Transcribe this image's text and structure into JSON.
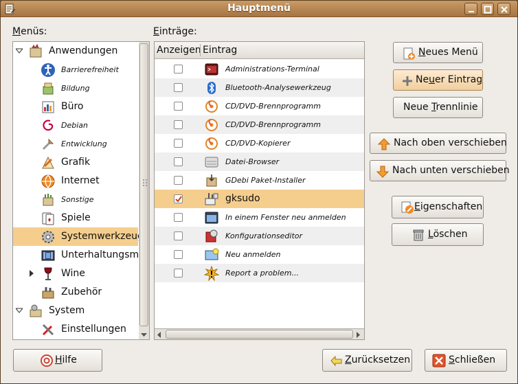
{
  "window": {
    "title": "Hauptmenü"
  },
  "menus_label": {
    "pre": "",
    "mnemonic": "M",
    "post": "enüs:"
  },
  "entries_label": {
    "pre": "",
    "mnemonic": "E",
    "post": "inträge:"
  },
  "tree": [
    {
      "label": "Anwendungen",
      "level": 0,
      "expander": "open",
      "icon": "applications-icon",
      "italic": false
    },
    {
      "label": "Barrierefreiheit",
      "level": 1,
      "icon": "accessibility-icon",
      "italic": true
    },
    {
      "label": "Bildung",
      "level": 1,
      "icon": "education-icon",
      "italic": true
    },
    {
      "label": "Büro",
      "level": 1,
      "icon": "office-icon",
      "italic": false
    },
    {
      "label": "Debian",
      "level": 1,
      "icon": "debian-icon",
      "italic": true
    },
    {
      "label": "Entwicklung",
      "level": 1,
      "icon": "development-icon",
      "italic": true
    },
    {
      "label": "Grafik",
      "level": 1,
      "icon": "graphics-icon",
      "italic": false
    },
    {
      "label": "Internet",
      "level": 1,
      "icon": "internet-icon",
      "italic": false
    },
    {
      "label": "Sonstige",
      "level": 1,
      "icon": "other-icon",
      "italic": true
    },
    {
      "label": "Spiele",
      "level": 1,
      "icon": "games-icon",
      "italic": false
    },
    {
      "label": "Systemwerkzeuge",
      "level": 1,
      "icon": "system-tools-icon",
      "italic": false,
      "selected": true
    },
    {
      "label": "Unterhaltungsmedien",
      "level": 1,
      "icon": "multimedia-icon",
      "italic": false
    },
    {
      "label": "Wine",
      "level": 1,
      "expander": "closed",
      "icon": "wine-icon",
      "italic": false
    },
    {
      "label": "Zubehör",
      "level": 1,
      "icon": "accessories-icon",
      "italic": false
    },
    {
      "label": "System",
      "level": 0,
      "expander": "open",
      "icon": "system-icon",
      "italic": false
    },
    {
      "label": "Einstellungen",
      "level": 1,
      "icon": "preferences-icon",
      "italic": false
    }
  ],
  "table": {
    "col_show": "Anzeigen",
    "col_entry": "Eintrag",
    "rows": [
      {
        "label": "Administrations-Terminal",
        "checked": false,
        "icon": "terminal-icon",
        "italic": true
      },
      {
        "label": "Bluetooth-Analysewerkzeug",
        "checked": false,
        "icon": "bluetooth-icon",
        "italic": true
      },
      {
        "label": "CD/DVD-Brennprogramm",
        "checked": false,
        "icon": "cd-burner-icon",
        "italic": true
      },
      {
        "label": "CD/DVD-Brennprogramm",
        "checked": false,
        "icon": "cd-burner-icon",
        "italic": true
      },
      {
        "label": "CD/DVD-Kopierer",
        "checked": false,
        "icon": "cd-copier-icon",
        "italic": true
      },
      {
        "label": "Datei-Browser",
        "checked": false,
        "icon": "file-browser-icon",
        "italic": true
      },
      {
        "label": "GDebi Paket-Installer",
        "checked": false,
        "icon": "package-installer-icon",
        "italic": true
      },
      {
        "label": "gksudo",
        "checked": true,
        "icon": "gksudo-icon",
        "italic": false,
        "selected": true
      },
      {
        "label": "In einem Fenster neu anmelden",
        "checked": false,
        "icon": "window-login-icon",
        "italic": true
      },
      {
        "label": "Konfigurationseditor",
        "checked": false,
        "icon": "config-editor-icon",
        "italic": true
      },
      {
        "label": "Neu anmelden",
        "checked": false,
        "icon": "relogin-icon",
        "italic": true
      },
      {
        "label": "Report a problem...",
        "checked": false,
        "icon": "report-problem-icon",
        "italic": true
      }
    ]
  },
  "buttons": {
    "new_menu": {
      "pre": "",
      "mnemonic": "N",
      "post": "eues Menü"
    },
    "new_entry": {
      "pre": "Ne",
      "mnemonic": "u",
      "post": "er Eintrag"
    },
    "new_separator": {
      "pre": "Neue ",
      "mnemonic": "T",
      "post": "rennlinie"
    },
    "move_up": {
      "pre": "Nach oben verschieben",
      "mnemonic": "",
      "post": ""
    },
    "move_down": {
      "pre": "Nach unten verschieben",
      "mnemonic": "",
      "post": ""
    },
    "properties": {
      "pre": "",
      "mnemonic": "E",
      "post": "igenschaften"
    },
    "delete": {
      "pre": "",
      "mnemonic": "L",
      "post": "öschen"
    },
    "help": {
      "pre": "",
      "mnemonic": "H",
      "post": "ilfe"
    },
    "revert": {
      "pre": "",
      "mnemonic": "Z",
      "post": "urücksetzen"
    },
    "close": {
      "pre": "",
      "mnemonic": "S",
      "post": "chließen"
    }
  },
  "colors": {
    "selection": "#f5ce8e",
    "titlebar": "#b5854f",
    "background": "#efebe7"
  }
}
